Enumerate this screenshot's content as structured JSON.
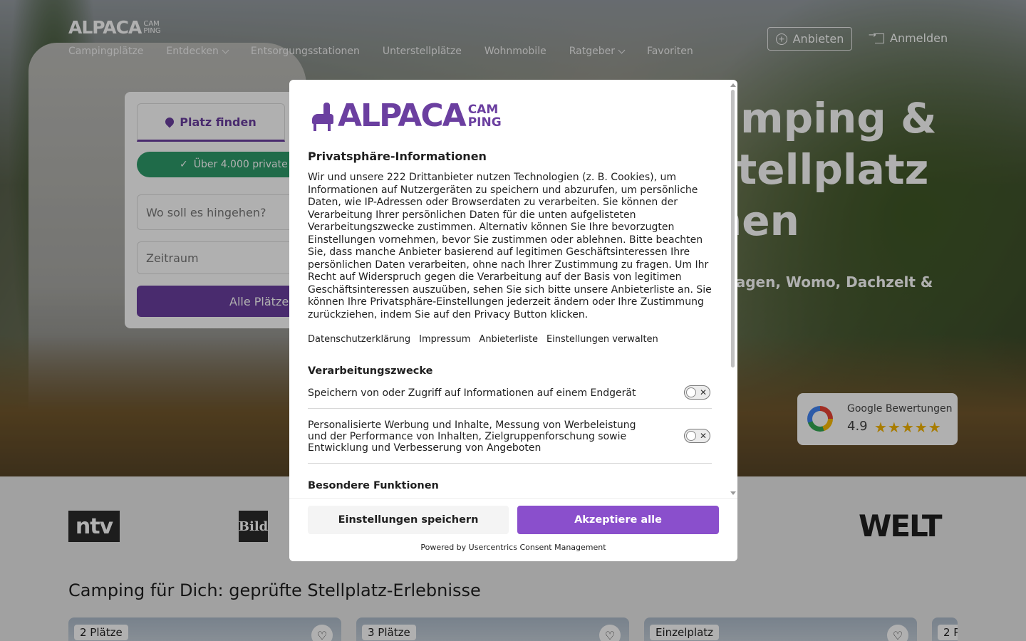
{
  "brand": {
    "word": "ALPACA",
    "sub1": "CAM",
    "sub2": "PING",
    "sub1_small": "CAM",
    "sub2_small": "PING"
  },
  "nav": {
    "items": [
      "Campingplätze",
      "Entdecken",
      "Entsorgungsstationen",
      "Unterstellplätze",
      "Wohnmobile",
      "Ratgeber",
      "Favoriten"
    ],
    "anbieten": "Anbieten",
    "anmelden": "Anmelden"
  },
  "hero": {
    "title_line1": "amping &",
    "title_line2": "stellplatz",
    "title_line3": "nen",
    "subtitle": "nwagen, Womo, Dachzelt &"
  },
  "search": {
    "tab_label": "Platz finden",
    "badge": "Über 4.000 private",
    "where_placeholder": "Wo soll es hingehen?",
    "zeitraum_placeholder": "Zeitraum",
    "button": "Alle Plätze"
  },
  "google": {
    "label": "Google Bewertungen",
    "score": "4.9",
    "stars": "★★★★★",
    "rating": 4.9
  },
  "press": {
    "ntv": "ntv",
    "bild": "Bild",
    "welt": "WELT"
  },
  "section_title": "Camping für Dich: geprüfte Stellplatz-Erlebnisse",
  "cards": [
    {
      "tag": "2 Plätze"
    },
    {
      "tag": "3 Plätze"
    },
    {
      "tag": "Einzelplatz"
    },
    {
      "tag": "2 P"
    }
  ],
  "consent": {
    "heading": "Privatsphäre-Informationen",
    "body": "Wir und unsere 222 Drittanbieter nutzen Technologien (z. B. Cookies), um Informationen auf Nutzergeräten zu speichern und abzurufen, um persönliche Daten, wie IP-Adressen oder Browserdaten zu verarbeiten. Sie können der Verarbeitung Ihrer persönlichen Daten für die unten aufgelisteten Verarbeitungszwecke zustimmen. Alternativ können Sie Ihre bevorzugten Einstellungen vornehmen, bevor Sie zustimmen oder ablehnen. Bitte beachten Sie, dass manche Anbieter basierend auf legitimen Geschäftsinteressen Ihre persönlichen Daten verarbeiten, ohne nach Ihrer Zustimmung zu fragen. Um Ihr Recht auf Widerspruch gegen die Verarbeitung auf der Basis von legitimen Geschäftsinteressen auszuüben, sehen Sie sich bitte unsere Anbieterliste an. Sie können Ihre Privatsphäre-Einstellungen jederzeit ändern oder Ihre Zustimmung zurückziehen, indem Sie auf den Privacy Button klicken.",
    "links": [
      "Datenschutzerklärung",
      "Impressum",
      "Anbieterliste",
      "Einstellungen verwalten"
    ],
    "purposes_heading": "Verarbeitungszwecke",
    "purposes": [
      {
        "label": "Speichern von oder Zugriff auf Informationen auf einem Endgerät",
        "enabled": false
      },
      {
        "label": "Personalisierte Werbung und Inhalte, Messung von Werbeleistung und der Performance von Inhalten, Zielgruppenforschung sowie Entwicklung und Verbesserung von Angeboten",
        "enabled": false
      }
    ],
    "special_heading": "Besondere Funktionen",
    "toggle_off_symbol": "✕",
    "save_button": "Einstellungen speichern",
    "accept_button": "Akzeptiere alle",
    "powered_by": "Powered by Usercentrics Consent Management"
  },
  "colors": {
    "brand_purple": "#6b3fa0",
    "accept_purple": "#8a4fcc",
    "badge_green": "#2d9c6b",
    "star_gold": "#f4b400"
  }
}
